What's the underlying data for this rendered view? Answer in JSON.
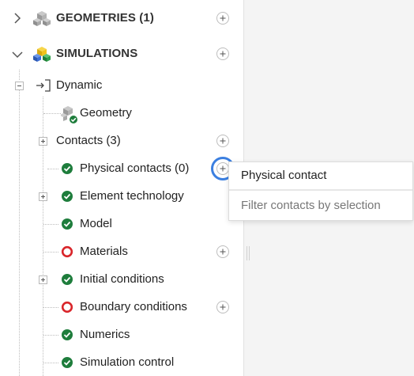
{
  "sections": {
    "geometries": {
      "label": "GEOMETRIES (1)",
      "icon": "cubes-icon",
      "expanded": false
    },
    "simulations": {
      "label": "SIMULATIONS",
      "icon": "colored-cubes-icon",
      "expanded": true
    }
  },
  "tree": {
    "dynamic": {
      "label": "Dynamic",
      "icon": "run-simulation-icon"
    },
    "geometry": {
      "label": "Geometry",
      "icon": "geometry-check-icon"
    },
    "contacts": {
      "label": "Contacts (3)"
    },
    "physical_contacts": {
      "label": "Physical contacts (0)",
      "status": "valid"
    },
    "element_technology": {
      "label": "Element technology",
      "status": "valid"
    },
    "model": {
      "label": "Model",
      "status": "valid"
    },
    "materials": {
      "label": "Materials",
      "status": "invalid"
    },
    "initial_conditions": {
      "label": "Initial conditions",
      "status": "valid"
    },
    "boundary_conditions": {
      "label": "Boundary conditions",
      "status": "invalid"
    },
    "numerics": {
      "label": "Numerics",
      "status": "valid"
    },
    "simulation_control": {
      "label": "Simulation control",
      "status": "valid"
    }
  },
  "context_menu": {
    "items": [
      "Physical contact",
      "Filter contacts by selection"
    ]
  },
  "colors": {
    "valid": "#1e7d3c",
    "invalid": "#d9262b",
    "highlight": "#3b7fe0",
    "cube_blue": "#3c6fd4",
    "cube_yellow": "#f2c21b",
    "cube_green": "#2e9e4a"
  }
}
